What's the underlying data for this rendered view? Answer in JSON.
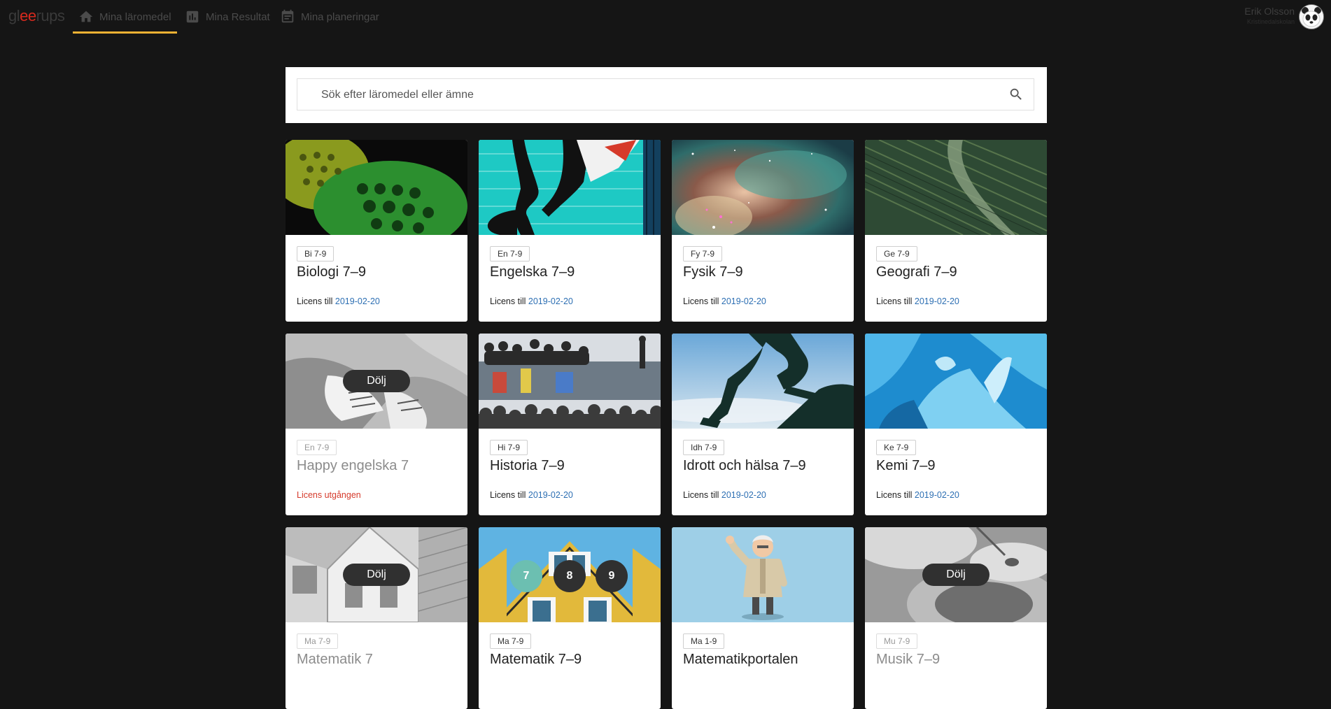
{
  "brand": {
    "part1": "gl",
    "part2": "ee",
    "part3": "rups"
  },
  "nav": [
    {
      "label": "Mina läromedel",
      "icon": "home-icon",
      "active": true
    },
    {
      "label": "Mina Resultat",
      "icon": "bar-chart-icon",
      "active": false
    },
    {
      "label": "Mina planeringar",
      "icon": "calendar-icon",
      "active": false
    }
  ],
  "user": {
    "name": "Erik Olsson",
    "school": "Kristinedalskolan"
  },
  "search": {
    "placeholder": "Sök efter läromedel eller ämne",
    "value": ""
  },
  "cards": [
    {
      "tag": "Bi 7-9",
      "title": "Biologi 7–9",
      "license_prefix": "Licens till",
      "license_date": "2019-02-20"
    },
    {
      "tag": "En 7-9",
      "title": "Engelska 7–9",
      "license_prefix": "Licens till",
      "license_date": "2019-02-20"
    },
    {
      "tag": "Fy 7-9",
      "title": "Fysik 7–9",
      "license_prefix": "Licens till",
      "license_date": "2019-02-20"
    },
    {
      "tag": "Ge 7-9",
      "title": "Geografi 7–9",
      "license_prefix": "Licens till",
      "license_date": "2019-02-20"
    },
    {
      "tag": "En 7-9",
      "title": "Happy engelska 7",
      "license_expired": "Licens utgången",
      "hide_label": "Dölj"
    },
    {
      "tag": "Hi 7-9",
      "title": "Historia 7–9",
      "license_prefix": "Licens till",
      "license_date": "2019-02-20"
    },
    {
      "tag": "Idh 7-9",
      "title": "Idrott och hälsa 7–9",
      "license_prefix": "Licens till",
      "license_date": "2019-02-20"
    },
    {
      "tag": "Ke 7-9",
      "title": "Kemi 7–9",
      "license_prefix": "Licens till",
      "license_date": "2019-02-20"
    },
    {
      "tag": "Ma 7-9",
      "title": "Matematik 7",
      "hide_label": "Dölj"
    },
    {
      "tag": "Ma 7-9",
      "title": "Matematik 7–9",
      "grades": [
        "7",
        "8",
        "9"
      ]
    },
    {
      "tag": "Ma 1-9",
      "title": "Matematikportalen"
    },
    {
      "tag": "Mu 7-9",
      "title": "Musik 7–9",
      "hide_label": "Dölj"
    }
  ],
  "colors": {
    "accent": "#f2b233",
    "link": "#2d6fb3",
    "expired": "#d53a2b",
    "grade_selected": "#6cbfb1"
  }
}
